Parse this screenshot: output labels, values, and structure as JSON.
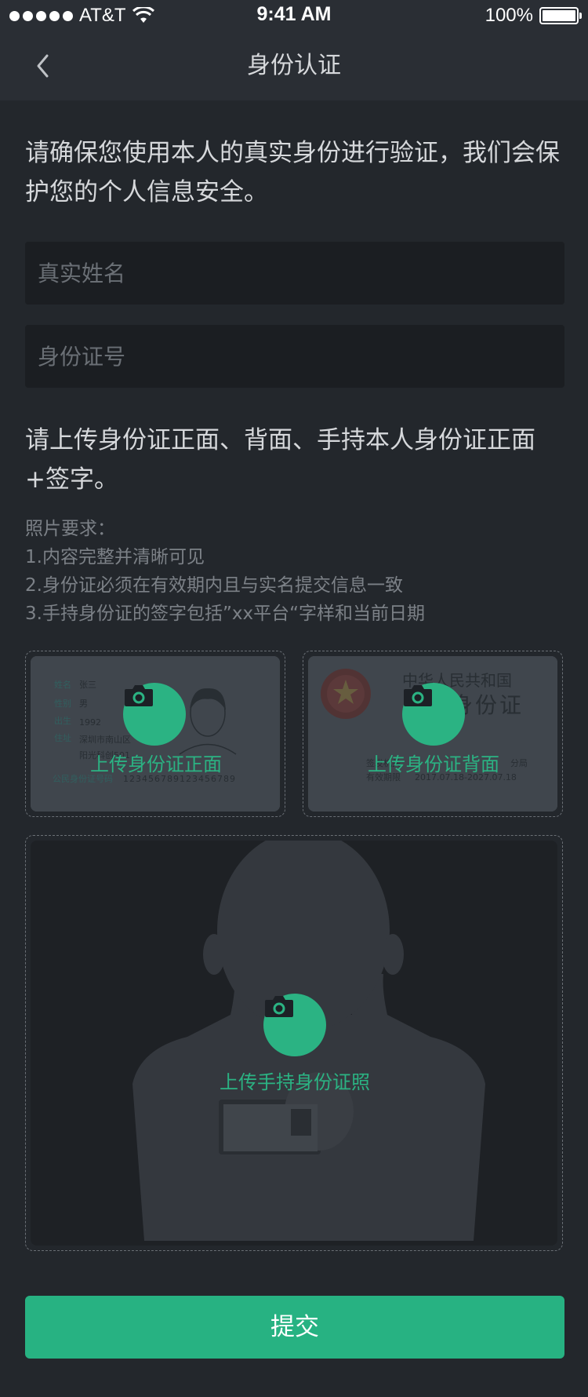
{
  "status_bar": {
    "carrier": "AT&T",
    "time": "9:41 AM",
    "battery": "100%"
  },
  "nav": {
    "title": "身份认证"
  },
  "intro": "请确保您使用本人的真实身份进行验证，我们会保护您的个人信息安全。",
  "form": {
    "name_placeholder": "真实姓名",
    "name_value": "",
    "id_placeholder": "身份证号",
    "id_value": ""
  },
  "upload": {
    "title": "请上传身份证正面、背面、手持本人身份证正面+签字。",
    "requirements": [
      "照片要求：",
      "1.内容完整并清晰可见",
      "2.身份证必须在有效期内且与实名提交信息一致",
      "3.手持身份证的签字包括”xx平台“字样和当前日期"
    ],
    "front_label": "上传身份证正面",
    "back_label": "上传身份证背面",
    "hand_label": "上传手持身份证照"
  },
  "id_front_sample": {
    "name_key": "姓名",
    "name_val": "张三",
    "gender_key": "性别",
    "gender_val": "男",
    "birth_key": "出生",
    "birth_val": "1992",
    "addr_key": "住址",
    "addr_val1": "深圳市南山区",
    "addr_val2": "阳光科创501",
    "id_key": "公民身份证号码",
    "id_val": "123456789123456789"
  },
  "id_back_sample": {
    "country": "中华人民共和国",
    "card_name": "居民身份证",
    "issuer_key": "签发机关",
    "issuer_val": "分局",
    "valid_key": "有效期限",
    "valid_val": "2017.07.18-2027.07.18"
  },
  "submit_label": "提交",
  "colors": {
    "accent": "#2bb383",
    "background": "#23272c",
    "field": "#1b1e22"
  }
}
